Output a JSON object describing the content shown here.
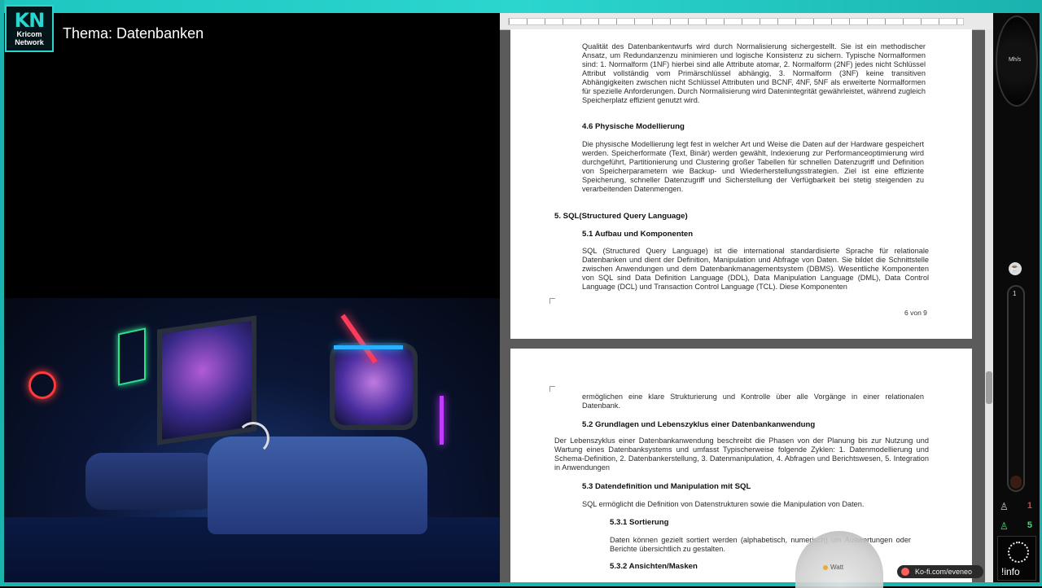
{
  "overlay": {
    "logo_mark": "KN",
    "logo_line1": "Kricom",
    "logo_line2": "Network",
    "topic": "Thema: Datenbanken",
    "ko_fi": "Ko-fi.com/eveneo",
    "watt_label": "Watt",
    "gauge_label": "Mh/s",
    "info_label": "!info",
    "tube_value": "1",
    "stat_values": [
      "1",
      "5"
    ],
    "accent_color": "#2bd6cf"
  },
  "document": {
    "page1": {
      "para_normalization": "Qualität des Datenbankentwurfs wird durch Normalisierung sichergestellt. Sie ist ein methodischer Ansatz, um Redundanzenzu minimieren und logische Konsistenz zu sichern. Typische Normalformen sind: 1. Normalform (1NF) hierbei sind alle Attribute atomar, 2. Normalform (2NF) jedes nicht Schlüssel Attribut vollständig vom Primärschlüssel abhängig, 3. Normalform (3NF) keine transitiven Abhängigkeiten zwischen nicht Schlüssel Attributen und BCNF, 4NF, 5NF als erweiterte Normalformen für spezielle Anforderungen. Durch Normalisierung wird Datenintegrität gewährleistet, während zugleich Speicherplatz effizient genutzt wird.",
      "heading_46": "4.6 Physische Modellierung",
      "para_46": "Die physische Modellierung legt fest in welcher Art und Weise die Daten auf der Hardware gespeichert werden. Speicherformate (Text, Binär) werden gewählt, Indexierung zur Performanceoptimierung wird durchgeführt, Partitionierung und Clustering großer Tabellen für schnellen Datenzugriff und Definition von Speicherparametern wie Backup- und Wiederherstellungsstrategien. Ziel ist eine effiziente Speicherung, schneller Datenzugriff und Sicherstellung der Verfügbarkeit bei stetig steigenden zu verarbeitenden Datenmengen.",
      "heading_5": "5. SQL(Structured Query Language)",
      "heading_51": "5.1 Aufbau und Komponenten",
      "para_51": "SQL (Structured Query Language) ist die international standardisierte Sprache für relationale Datenbanken und dient der Definition, Manipulation und Abfrage von Daten. Sie bildet die Schnittstelle zwischen Anwendungen und dem Datenbankmanagementsystem (DBMS). Wesentliche Komponenten von SQL sind Data Definition Language (DDL), Data Manipulation Language (DML), Data Control Language (DCL) und Transaction Control Language (TCL). Diese Komponenten",
      "page_number": "6 von 9"
    },
    "page2": {
      "para_cont": "ermöglichen eine klare Strukturierung und Kontrolle über alle Vorgänge in einer relationalen Datenbank.",
      "heading_52": "5.2 Grundlagen und Lebenszyklus einer Datenbankanwendung",
      "para_52": "Der Lebenszyklus einer Datenbankanwendung beschreibt die Phasen von der Planung bis zur Nutzung und Wartung eines Datenbanksystems und umfasst Typischerweise folgende Zyklen: 1. Datenmodellierung und Schema-Definition, 2. Datenbankerstellung, 3. Datenmanipulation, 4. Abfragen und Berichtswesen, 5. Integration in Anwendungen",
      "heading_53": "5.3 Datendefinition und Manipulation mit SQL",
      "para_53": "SQL ermöglicht die Definition von Datenstrukturen sowie die Manipulation von Daten.",
      "heading_531": "5.3.1 Sortierung",
      "para_531": "Daten können gezielt sortiert werden (alphabetisch, numerisch) um Auswertungen oder Berichte übersichtlich zu gestalten.",
      "heading_532": "5.3.2 Ansichten/Masken"
    }
  }
}
